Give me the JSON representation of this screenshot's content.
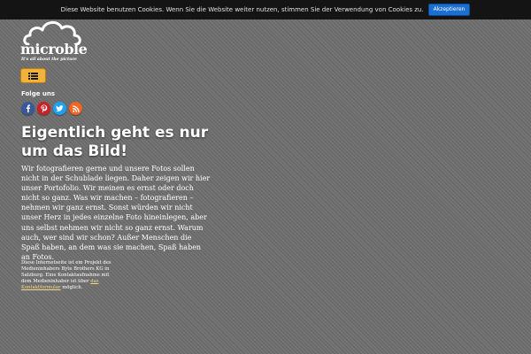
{
  "cookie_bar": {
    "text": "Diese Website benutzen Cookies. Wenn Sie die Website weiter nutzen, stimmen Sie der Verwendung von Cookies zu.",
    "accept_label": "Akzeptieren",
    "accept_color": "#1a6fd0"
  },
  "logo": {
    "name": "microble",
    "tagline": "It's all about the picture"
  },
  "menu": {
    "icon": "list-icon",
    "color": "#f0b23a"
  },
  "social": {
    "label": "Folge uns",
    "icons": [
      {
        "name": "facebook-icon",
        "color": "#3b5998"
      },
      {
        "name": "pinterest-icon",
        "color": "#cb2027"
      },
      {
        "name": "twitter-icon",
        "color": "#1da1f2"
      },
      {
        "name": "rss-icon",
        "color": "#f26522"
      }
    ]
  },
  "main": {
    "headline": "Eigentlich geht es nur um das Bild!",
    "intro": "Wir fotografieren gerne und unsere Fotos sollen nicht in der Schublade liegen. Daher zeigen wir hier unser Portofolio. Wir meinen es ernst oder doch nicht so ganz. Was wir machen – fotografieren – nehmen wir ganz ernst. Sonst würden wir nicht unser Herz in jedes einzelne Foto hineinlegen, aber uns selbst nehmen wir nicht so ganz ernst. Warum auch, wer sind wir schon? Außer Menschen die Spaß haben, an dem was sie machen, Spaß haben an Fotos."
  },
  "footer": {
    "text_before": "Diese Internetseite ist ein Projekt des Medieninhabers Byte Brothers KG in Salzburg. Eine Kontaktaufnahme mit dem Medieninhaber ist über ",
    "link_text": "das Kontaktformular",
    "text_after": " möglich."
  }
}
